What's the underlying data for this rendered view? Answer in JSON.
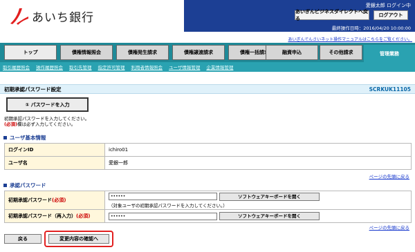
{
  "header": {
    "logo_text": "あいち銀行",
    "user_label": "愛銀太郎 ログイン中",
    "direct_button": "あいぎんビジネスダイレクトへ戻る",
    "logout_button": "ログアウト",
    "last_login": "最終操作日時：2016/04/20 10:00:00",
    "manual_link": "あいぎんでんさいネット操作マニュアルはこちらをご覧ください。",
    "brand_color": "#1c3f94"
  },
  "tabs": [
    {
      "label": "トップ"
    },
    {
      "label": "債権情報照会"
    },
    {
      "label": "債権発生請求"
    },
    {
      "label": "債権譲渡請求"
    },
    {
      "label": "債権一括請求"
    },
    {
      "label": "融資申込"
    },
    {
      "label": "その他請求"
    },
    {
      "label": "管理業務"
    }
  ],
  "subnav": [
    "取引履歴照会",
    "操作履歴照会",
    "取引先管理",
    "指定許可管理",
    "利用者情報照会",
    "ユーザ情報管理",
    "企業情報管理"
  ],
  "page": {
    "title": "初期承認パスワード設定",
    "screen_code": "SCRKUK11105",
    "step_label": "① パスワードを入力",
    "instruction_1": "初期承認パスワードを入力してください。",
    "instruction_req": "(必須)",
    "instruction_2": "欄は必ず入力してください。"
  },
  "user_info": {
    "section_title": "ユーザ基本情報",
    "rows": [
      {
        "label": "ログインID",
        "value": "ichiro01"
      },
      {
        "label": "ユーザ名",
        "value": "愛銀一郎"
      }
    ]
  },
  "pw_section": {
    "section_title": "承認パスワード",
    "row1_label": "初期承認パスワード",
    "row2_label": "初期承認パスワード（再入力）",
    "req": "(必須)",
    "input_value": "••••••",
    "keyboard_button": "ソフトウェアキーボードを開く",
    "note": "（対象ユーザの初期承認パスワードを入力してください。）"
  },
  "page_top_link": "ページの先頭に戻る",
  "buttons": {
    "back": "戻る",
    "confirm": "変更内容の確認へ"
  }
}
